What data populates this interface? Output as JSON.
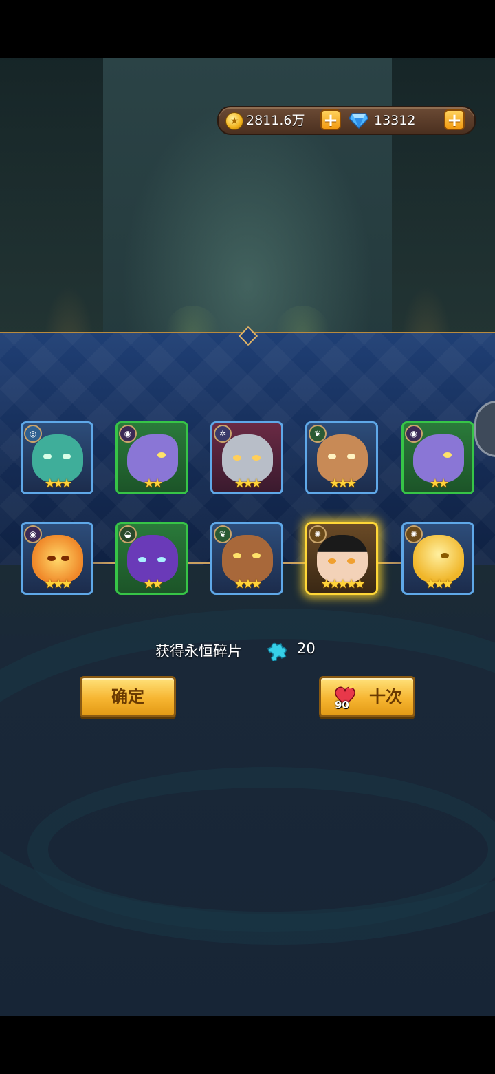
{
  "currency": {
    "gold_amount": "2811.6万",
    "gem_amount": "13312",
    "plus_label": "+"
  },
  "heroes": [
    {
      "stars": "★★★",
      "element": "light-icon"
    },
    {
      "stars": "★★",
      "element": "dark-icon"
    },
    {
      "stars": "★★★",
      "element": "void-icon"
    },
    {
      "stars": "★★★",
      "element": "nature-icon"
    },
    {
      "stars": "★★",
      "element": "dark-icon"
    },
    {
      "stars": "★★★",
      "element": "dark-icon"
    },
    {
      "stars": "★★",
      "element": "earth-icon"
    },
    {
      "stars": "★★★",
      "element": "nature-icon"
    },
    {
      "stars": "★★★★★",
      "element": "sun-icon"
    },
    {
      "stars": "★★★",
      "element": "sun-icon"
    }
  ],
  "reward": {
    "text": "获得永恒碎片",
    "amount": "20"
  },
  "buttons": {
    "confirm_label": "确定",
    "ten_label": "十次",
    "ten_cost": "90"
  },
  "colors": {
    "rare_border": "#5fa8e8",
    "uncommon_border": "#37c447",
    "legendary_border": "#ffd737"
  }
}
